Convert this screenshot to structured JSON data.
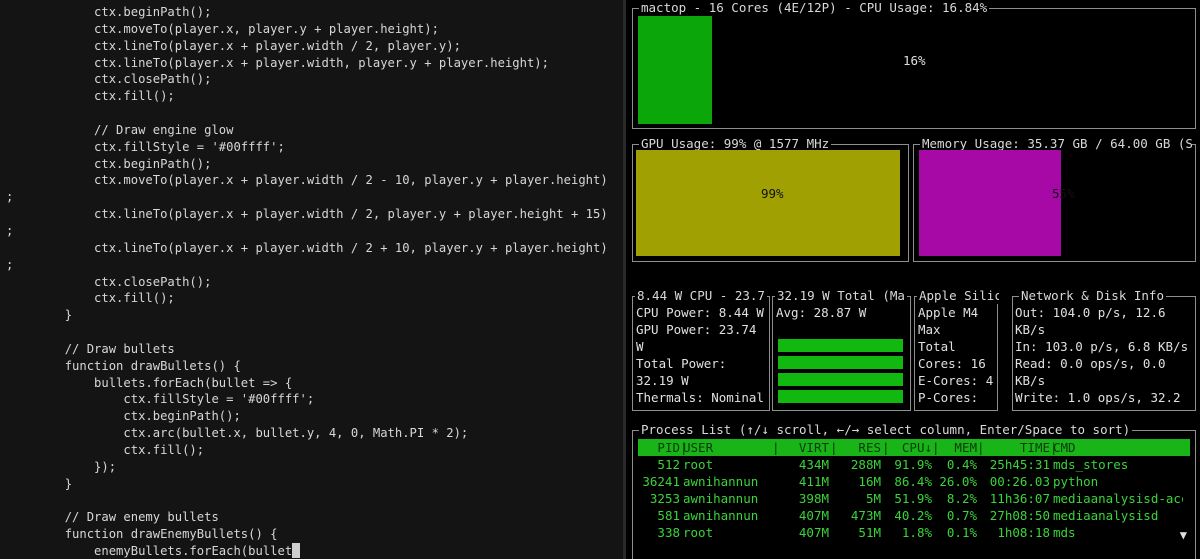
{
  "editor": {
    "lines": [
      "            ctx.beginPath();",
      "            ctx.moveTo(player.x, player.y + player.height);",
      "            ctx.lineTo(player.x + player.width / 2, player.y);",
      "            ctx.lineTo(player.x + player.width, player.y + player.height);",
      "            ctx.closePath();",
      "            ctx.fill();",
      "",
      "            // Draw engine glow",
      "            ctx.fillStyle = '#00ffff';",
      "            ctx.beginPath();",
      "            ctx.moveTo(player.x + player.width / 2 - 10, player.y + player.height)",
      ";",
      "            ctx.lineTo(player.x + player.width / 2, player.y + player.height + 15)",
      ";",
      "            ctx.lineTo(player.x + player.width / 2 + 10, player.y + player.height)",
      ";",
      "            ctx.closePath();",
      "            ctx.fill();",
      "        }",
      "",
      "        // Draw bullets",
      "        function drawBullets() {",
      "            bullets.forEach(bullet => {",
      "                ctx.fillStyle = '#00ffff';",
      "                ctx.beginPath();",
      "                ctx.arc(bullet.x, bullet.y, 4, 0, Math.PI * 2);",
      "                ctx.fill();",
      "            });",
      "        }",
      "",
      "        // Draw enemy bullets",
      "        function drawEnemyBullets() {",
      "            enemyBullets.forEach(bullet"
    ]
  },
  "cpu_panel": {
    "title": "mactop - 16 Cores (4E/12P) - CPU Usage: 16.84%",
    "percent_label": "16%",
    "usage": 0.1684,
    "bar_color": "#0aa60a"
  },
  "gpu_panel": {
    "title": "GPU Usage: 99% @ 1577 MHz",
    "percent_label": "99%",
    "usage": 0.99,
    "bar_color": "#a1a003"
  },
  "memory_panel": {
    "title": "Memory Usage: 35.37 GB / 64.00 GB (S",
    "percent_label": "55%",
    "usage": 0.55,
    "bar_color": "#a709a7"
  },
  "cpu_power_panel": {
    "title": "8.44 W CPU - 23.7",
    "lines": [
      "CPU Power: 8.44 W",
      "GPU Power: 23.74",
      "W",
      "Total Power:",
      "32.19 W",
      "Thermals: Nominal"
    ]
  },
  "total_power_panel": {
    "title": "32.19 W Total (Ma",
    "avg": "Avg: 28.87 W",
    "bar_count": 4
  },
  "apple_panel": {
    "title": "Apple Silic",
    "lines": [
      "Apple M4",
      "Max",
      "Total",
      "Cores: 16",
      "E-Cores: 4",
      "P-Cores:"
    ]
  },
  "network_panel": {
    "title": "Network & Disk Info",
    "lines": [
      "Out: 104.0 p/s, 12.6",
      "KB/s",
      "In: 103.0 p/s, 6.8 KB/s",
      "Read: 0.0 ops/s, 0.0",
      "KB/s",
      "Write: 1.0 ops/s, 32.2"
    ]
  },
  "process_panel": {
    "title": "Process List (↑/↓ scroll, ←/→ select column, Enter/Space to sort)",
    "headers": {
      "pid": "PID",
      "user": "USER",
      "virt": "VIRT",
      "res": "RES",
      "cpu": "CPU↓",
      "mem": "MEM",
      "time": "TIME",
      "cmd": "CMD"
    },
    "rows": [
      {
        "pid": "512",
        "user": "root",
        "virt": "434M",
        "res": "288M",
        "cpu": "91.9%",
        "mem": "0.4%",
        "time": "25h45:31",
        "cmd": "mds_stores"
      },
      {
        "pid": "36241",
        "user": "awnihannun",
        "virt": "411M",
        "res": "16M",
        "cpu": "86.4%",
        "mem": "26.0%",
        "time": "00:26.03",
        "cmd": "python"
      },
      {
        "pid": "3253",
        "user": "awnihannun",
        "virt": "398M",
        "res": "5M",
        "cpu": "51.9%",
        "mem": "8.2%",
        "time": "11h36:07",
        "cmd": "mediaanalysisd-acc…"
      },
      {
        "pid": "581",
        "user": "awnihannun",
        "virt": "407M",
        "res": "473M",
        "cpu": "40.2%",
        "mem": "0.7%",
        "time": "27h08:50",
        "cmd": "mediaanalysisd"
      },
      {
        "pid": "338",
        "user": "root",
        "virt": "407M",
        "res": "51M",
        "cpu": "1.8%",
        "mem": "0.1%",
        "time": "1h08:18",
        "cmd": "mds"
      }
    ],
    "scroll_icon": "▼"
  }
}
